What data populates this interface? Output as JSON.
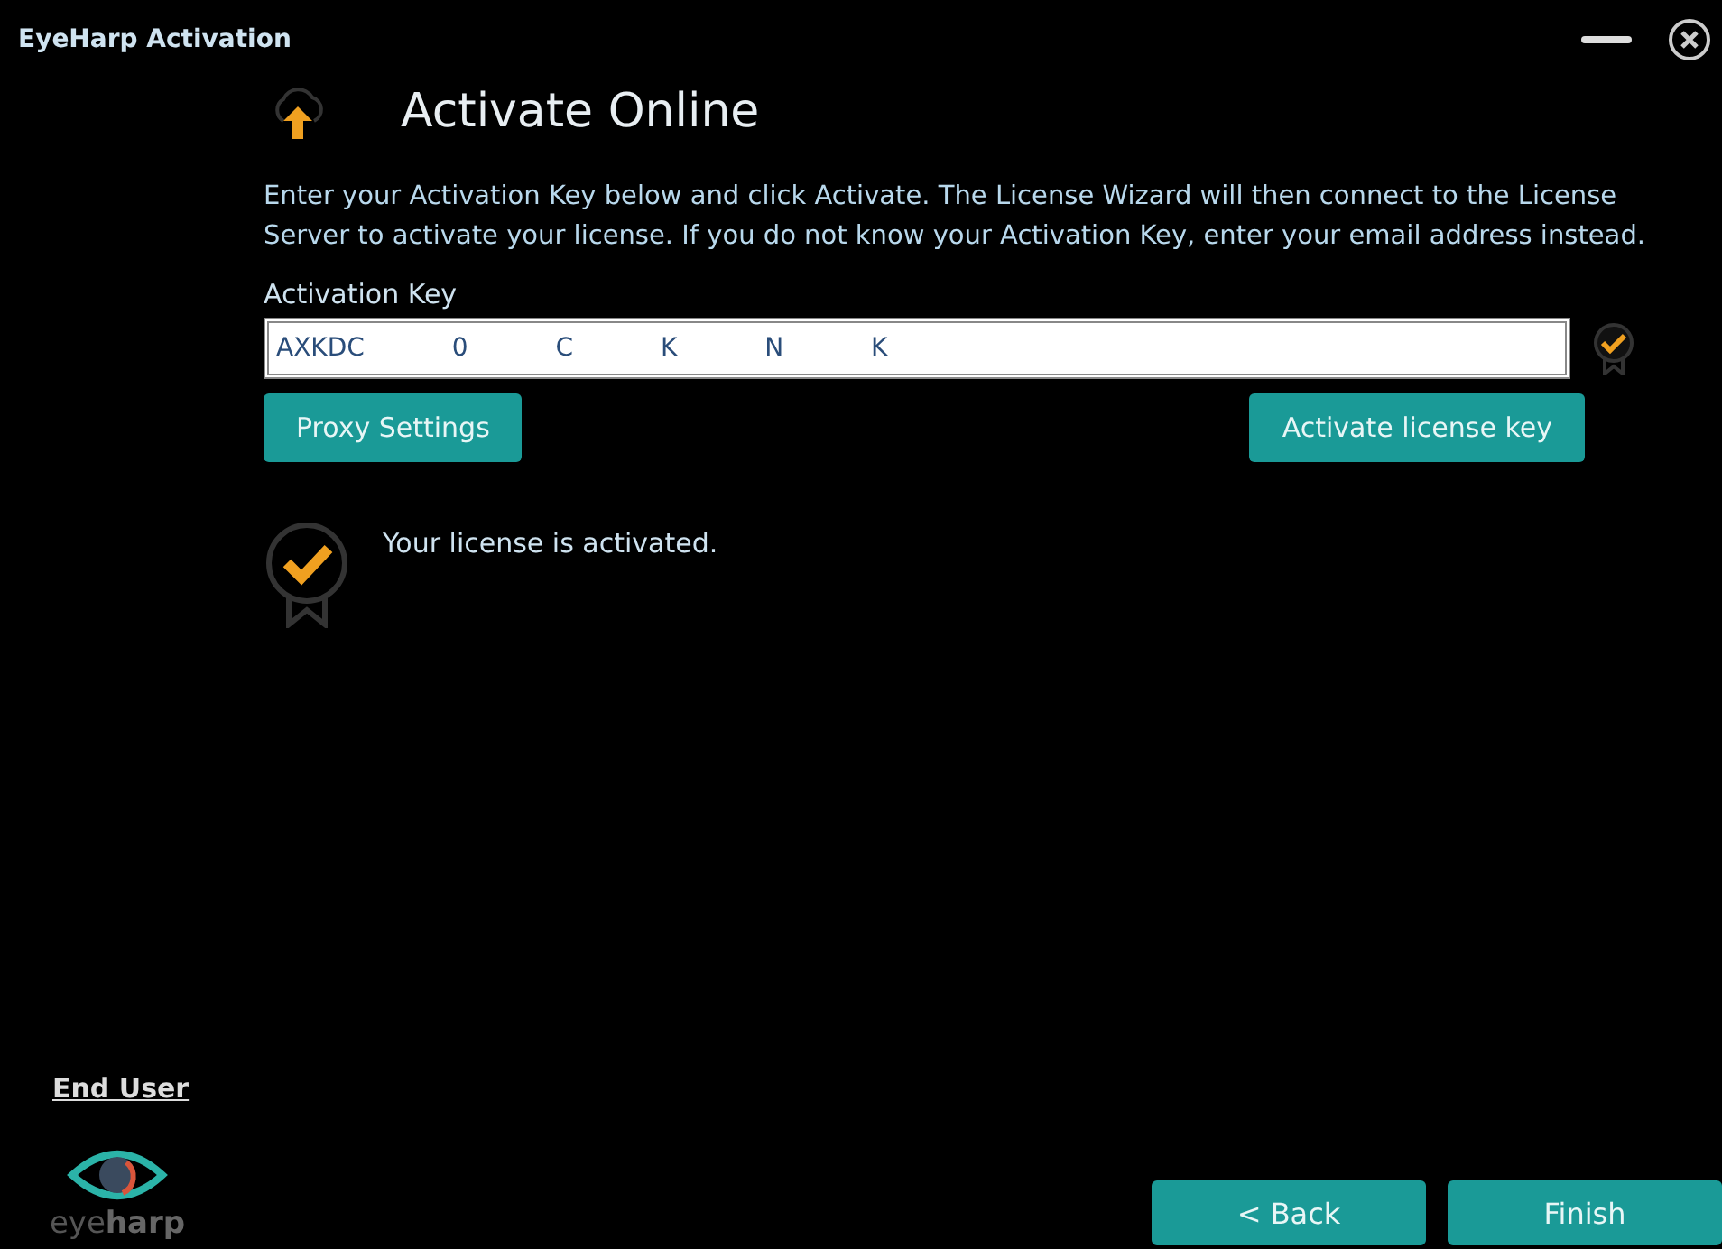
{
  "window": {
    "title": "EyeHarp Activation"
  },
  "heading": "Activate Online",
  "intro": "Enter your Activation Key below and click Activate. The License Wizard will then connect to the License Server to activate your license. If you do not know your Activation Key, enter your email address instead.",
  "activation_key": {
    "label": "Activation Key",
    "value": "AXKDC 0 C K N K",
    "verified": true
  },
  "buttons": {
    "proxy": "Proxy Settings",
    "activate": "Activate license key",
    "back": "< Back",
    "finish": "Finish"
  },
  "status": {
    "message": "Your license is activated.",
    "activated": true
  },
  "sidebar": {
    "link": "End User",
    "logo": "eye**harp**"
  }
}
